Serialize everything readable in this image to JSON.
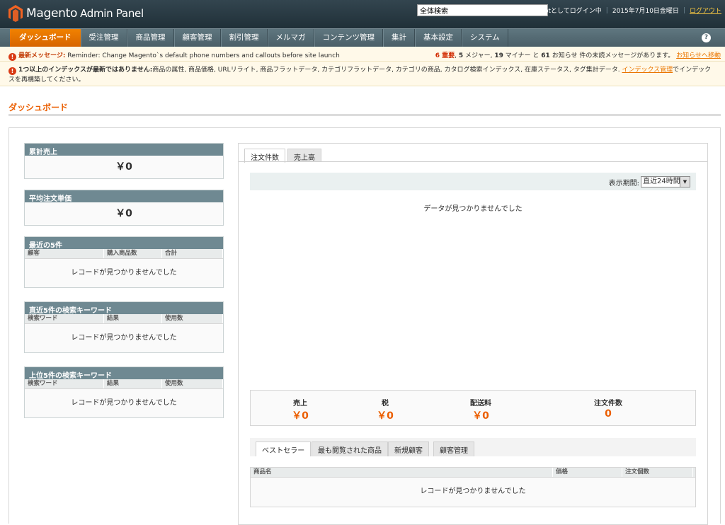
{
  "header": {
    "brand": "Magento",
    "brand_sub": "Admin Panel",
    "search_value": "全体検索",
    "login_info": "rootとしてログイン中",
    "date": "2015年7月10日金曜日",
    "logout": "ログアウト"
  },
  "nav": {
    "items": [
      "ダッシュボード",
      "受注管理",
      "商品管理",
      "顧客管理",
      "割引管理",
      "メルマガ",
      "コンテンツ管理",
      "集計",
      "基本設定",
      "システム"
    ],
    "help": "?"
  },
  "notices": {
    "latest_label": "最新メッセージ:",
    "latest_text": "Reminder: Change Magento`s default phone numbers and callouts before site launch",
    "count_critical": "6 重要",
    "count_major": "5",
    "count_minor": "19",
    "count_notice": "61",
    "counts_text_major": "メジャー",
    "counts_text_minor": "マイナー と",
    "counts_text_notice": "お知らせ 件の未読メッセージがあります。",
    "notice_link": "お知らせへ移動",
    "index_label": "1つ以上のインデックスが最新ではありません:",
    "index_text": "商品の属性, 商品価格, URLリライト, 商品フラットデータ, カテゴリフラットデータ, カテゴリの商品, カタログ検索インデックス, 在庫ステータス, タグ集計データ.",
    "index_link": "インデックス管理",
    "index_suffix": "でインデックスを再構築してください。"
  },
  "page_title": "ダッシュボード",
  "widgets": {
    "lifetime_sales": {
      "title": "累計売上",
      "value": "￥0"
    },
    "avg_order": {
      "title": "平均注文単価",
      "value": "￥0"
    },
    "last_orders": {
      "title": "最近の5件",
      "cols": [
        "顧客",
        "購入商品数",
        "合計"
      ],
      "empty": "レコードが見つかりませんでした"
    },
    "last_search": {
      "title": "直近5件の検索キーワード",
      "cols": [
        "検索ワード",
        "結果",
        "使用数"
      ],
      "empty": "レコードが見つかりませんでした"
    },
    "top_search": {
      "title": "上位5件の検索キーワード",
      "cols": [
        "検索ワード",
        "結果",
        "使用数"
      ],
      "empty": "レコードが見つかりませんでした"
    }
  },
  "chart_panel": {
    "tabs": [
      "注文件数",
      "売上高"
    ],
    "range_label": "表示期間:",
    "range_value": "直近24時間",
    "no_data": "データが見つかりませんでした"
  },
  "totals": [
    {
      "label": "売上",
      "value": "￥0"
    },
    {
      "label": "税",
      "value": "￥0"
    },
    {
      "label": "配送料",
      "value": "￥0"
    },
    {
      "label": "注文件数",
      "value": "0"
    }
  ],
  "bottom_tabs": [
    "ベストセラー",
    "最も閲覧された商品",
    "新規顧客",
    "顧客管理"
  ],
  "bottom_grid": {
    "cols": [
      "商品名",
      "価格",
      "注文個数"
    ],
    "empty": "レコードが見つかりませんでした"
  }
}
